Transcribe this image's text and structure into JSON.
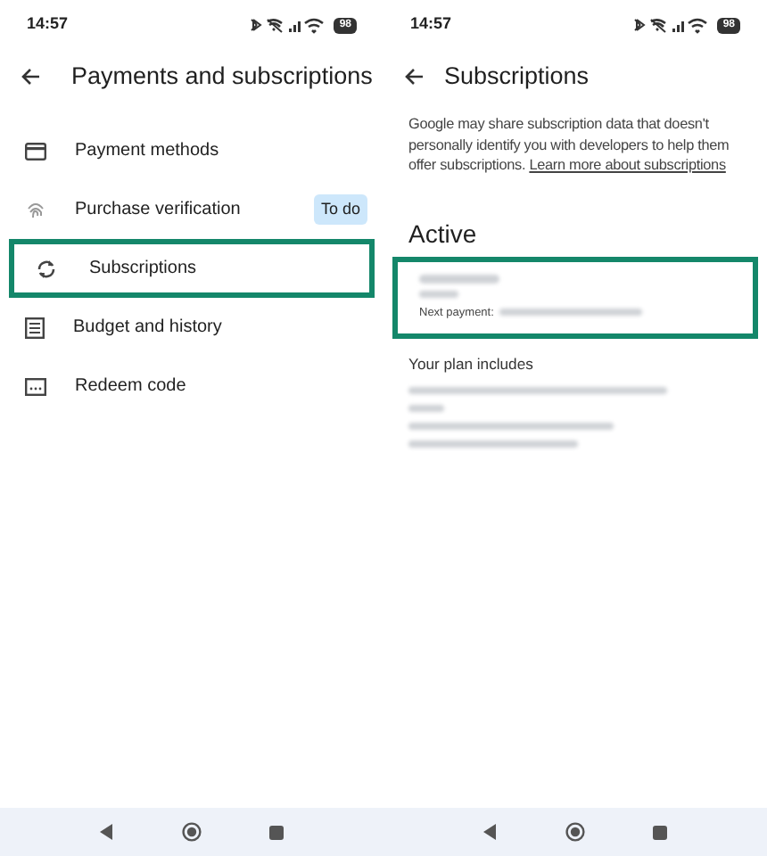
{
  "screens": [
    {
      "kind": "menu",
      "status_bar": {
        "time": "14:57",
        "battery": "98"
      },
      "title": "Payments and subscriptions",
      "items": [
        {
          "label": "Payment methods",
          "highlighted": false
        },
        {
          "label": "Purchase verification",
          "badge": "To do",
          "highlighted": false
        },
        {
          "label": "Subscriptions",
          "highlighted": true
        },
        {
          "label": "Budget and history",
          "highlighted": false
        },
        {
          "label": "Redeem code",
          "highlighted": false
        }
      ]
    },
    {
      "kind": "detail",
      "status_bar": {
        "time": "14:57",
        "battery": "98"
      },
      "title": "Subscriptions",
      "intro": "Google may share subscription data that doesn't personally identify you with developers to help them offer subscriptions.",
      "link": "Learn more about subscriptions",
      "section": "Active",
      "card": {
        "highlighted": true,
        "next_payment_label": "Next payment:"
      },
      "plan_heading": "Your plan includes"
    }
  ]
}
